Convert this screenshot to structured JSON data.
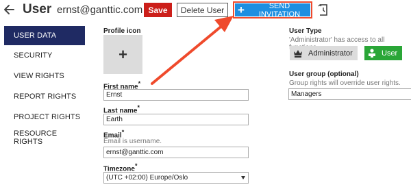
{
  "header": {
    "title": "User",
    "email": "ernst@ganttic.com",
    "save_label": "Save",
    "delete_label": "Delete User",
    "invite_label": "SEND INVITATION"
  },
  "sidebar": {
    "items": [
      {
        "label": "USER DATA"
      },
      {
        "label": "SECURITY"
      },
      {
        "label": "VIEW RIGHTS"
      },
      {
        "label": "REPORT RIGHTS"
      },
      {
        "label": "PROJECT RIGHTS"
      },
      {
        "label": "RESOURCE RIGHTS"
      }
    ]
  },
  "form": {
    "profile_icon_label": "Profile icon",
    "profile_icon_add": "+",
    "first_name_label": "First name",
    "first_name_value": "Ernst",
    "last_name_label": "Last name",
    "last_name_value": "Earth",
    "email_label": "Email",
    "email_hint": "Email is username.",
    "email_value": "ernst@ganttic.com",
    "timezone_label": "Timezone",
    "timezone_value": "(UTC +02:00) Europe/Oslo",
    "required_mark": "*"
  },
  "user_type": {
    "label": "User Type",
    "hint": "'Administrator' has access to all functions.",
    "admin_label": "Administrator",
    "user_label": "User"
  },
  "user_group": {
    "label": "User group (optional)",
    "hint": "Group rights will override user rights.",
    "value": "Managers"
  },
  "colors": {
    "save": "#cc1f1a",
    "invite": "#1e8fe1",
    "annotation": "#ef4a2c",
    "sidebar_active": "#1f2a63",
    "user_role": "#2aa637"
  },
  "icons": [
    "back-arrow-icon",
    "plus-icon",
    "history-icon",
    "crown-icon",
    "user-icon",
    "chevron-down-icon"
  ]
}
